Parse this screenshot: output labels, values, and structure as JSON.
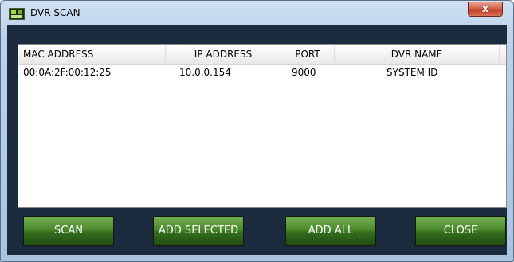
{
  "window": {
    "title": "DVR SCAN",
    "close_symbol": "x"
  },
  "table": {
    "headers": [
      "MAC ADDRESS",
      "IP ADDRESS",
      "PORT",
      "DVR NAME"
    ],
    "rows": [
      {
        "mac": "00:0A:2F:00:12:25",
        "ip": "10.0.0.154",
        "port": "9000",
        "name": "SYSTEM ID"
      }
    ]
  },
  "buttons": {
    "scan": "SCAN",
    "add_selected": "ADD SELECTED",
    "add_all": "ADD ALL",
    "close": "CLOSE"
  },
  "colors": {
    "button_green": "#4b8a2c",
    "panel_background": "#1b2b3e",
    "title_close_red": "#c23f28"
  },
  "icons": {
    "app": "dvr-app-icon",
    "window_close": "close-icon"
  }
}
